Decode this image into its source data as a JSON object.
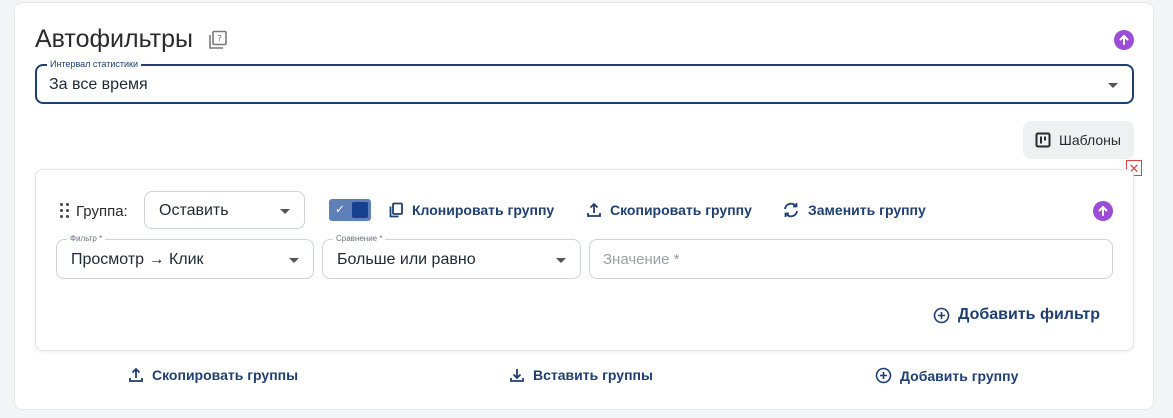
{
  "autofilters": {
    "title": "Автофильтры",
    "help_icon": "help-square-icon",
    "interval": {
      "label": "Интервал статистики",
      "value": "За все время"
    },
    "templates_label": "Шаблоны",
    "group": {
      "label": "Группа:",
      "action_select": "Оставить",
      "toggle_checked": true,
      "clone_label": "Клонировать группу",
      "copy_label": "Скопировать группу",
      "replace_label": "Заменить группу",
      "filter": {
        "label": "Фильтр *",
        "value": "Просмотр → Клик"
      },
      "comparison": {
        "label": "Сравнение *",
        "value": "Больше или равно"
      },
      "value_placeholder": "Значение *",
      "add_filter_label": "Добавить фильтр"
    },
    "footer": {
      "copy_groups_label": "Скопировать группы",
      "paste_groups_label": "Вставить группы",
      "add_group_label": "Добавить группу"
    }
  },
  "colors": {
    "accent": "#1f3f73",
    "purple": "#9b4dd6",
    "danger": "#dd4444"
  }
}
